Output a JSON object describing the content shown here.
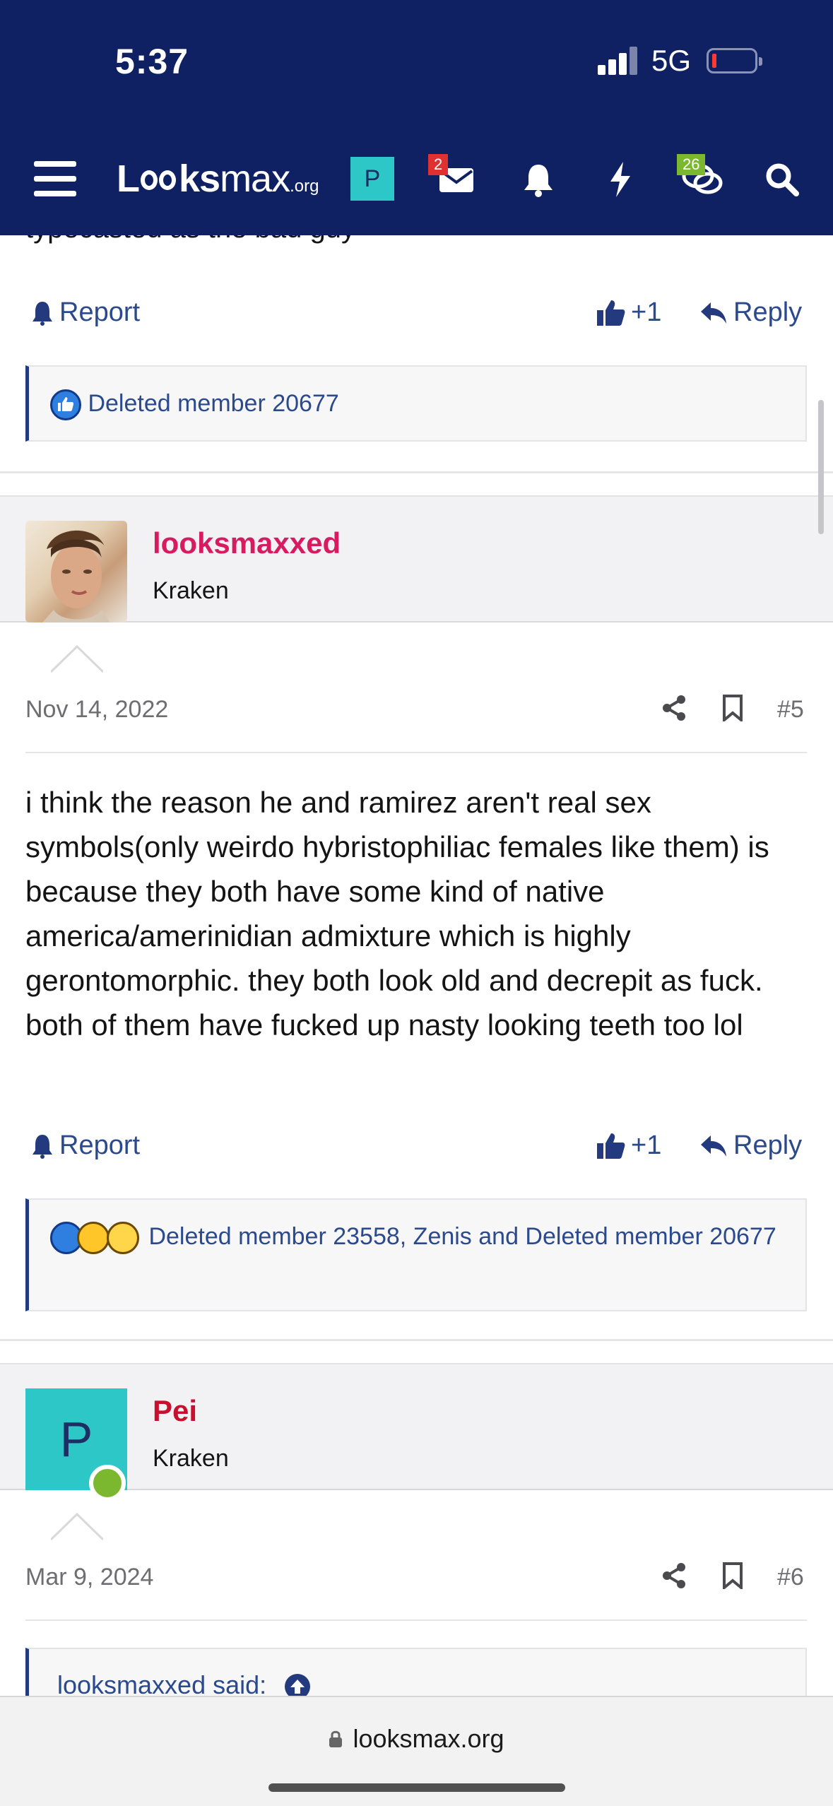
{
  "status_bar": {
    "time": "5:37",
    "network": "5G"
  },
  "nav": {
    "logo_main_1": "L",
    "logo_main_2": "ks",
    "logo_main_3": "max",
    "logo_org": ".org",
    "avatar_letter": "P",
    "messages_badge": "2",
    "chats_badge": "26"
  },
  "top_post": {
    "cut_text": "typecasted as the bad guy",
    "report_label": "Report",
    "like_count": "+1",
    "reply_label": "Reply",
    "reactions_text": "Deleted member 20677"
  },
  "post5": {
    "username": "looksmaxxed",
    "user_title": "Kraken",
    "date": "Nov 14, 2022",
    "post_number": "#5",
    "body": "i think the reason he and ramirez aren't real sex symbols(only weirdo hybristophiliac females like them) is because they both have some kind of native america/amerinidian admixture which is highly gerontomorphic. they both look old and decrepit as fuck. both of them have fucked up nasty looking teeth too lol",
    "report_label": "Report",
    "like_count": "+1",
    "reply_label": "Reply",
    "reactions_text": "Deleted member 23558, Zenis and Deleted member 20677"
  },
  "post6": {
    "username": "Pei",
    "avatar_letter": "P",
    "user_title": "Kraken",
    "date": "Mar 9, 2024",
    "post_number": "#6",
    "quote_header": "looksmaxxed said:"
  },
  "browser": {
    "url": "looksmax.org"
  },
  "colors": {
    "nav_bg": "#0f2163",
    "link_blue": "#2b4a8e",
    "username_pink": "#d81b60",
    "username_red": "#c8102e",
    "avatar_teal": "#2ec7c7",
    "online_green": "#7cb82f"
  }
}
